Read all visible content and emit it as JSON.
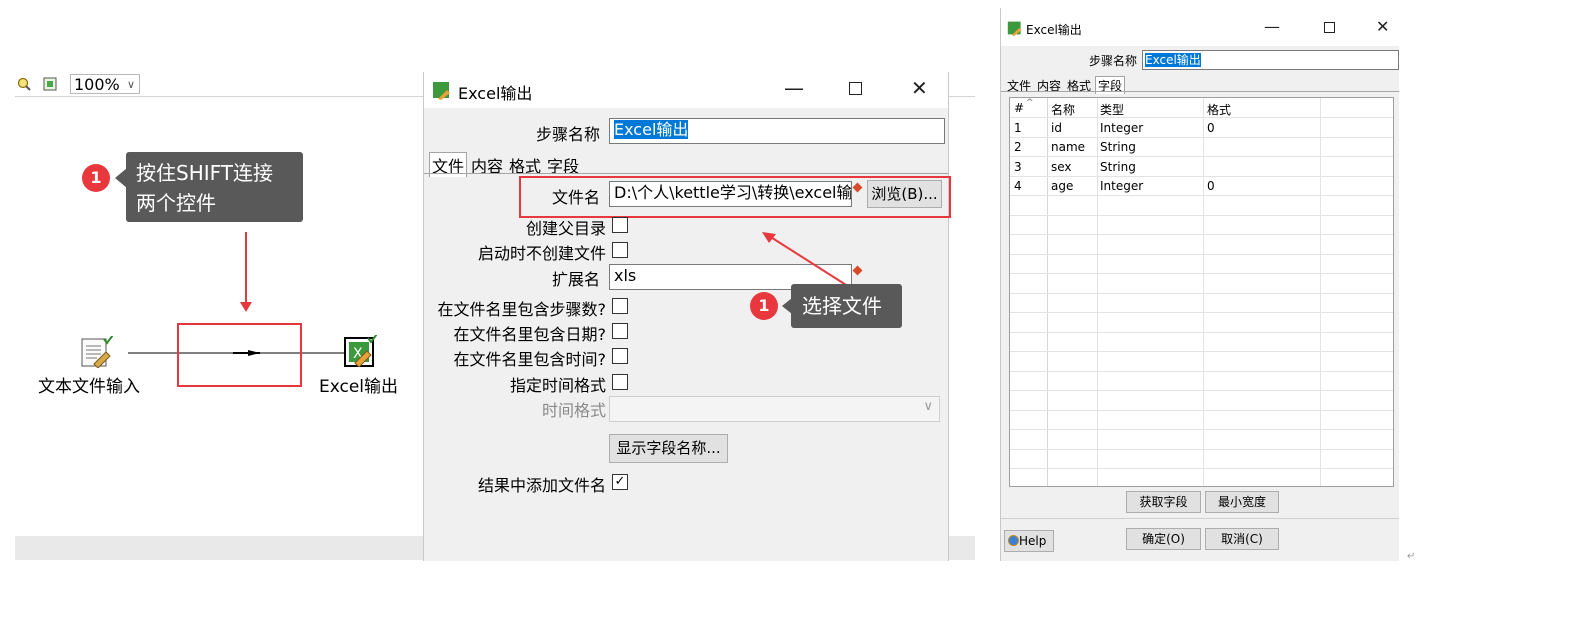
{
  "canvas": {
    "zoom": "100%",
    "steps": {
      "input_label": "文本文件输入",
      "output_label": "Excel输出"
    },
    "callout_badge": "1",
    "callout_text_line1": "按住SHIFT连接",
    "callout_text_line2": "两个控件"
  },
  "dialog1": {
    "title": "Excel输出",
    "step_name_label": "步骤名称",
    "step_name_value": "Excel输出",
    "tabs": [
      "文件",
      "内容",
      "格式",
      "字段"
    ],
    "filename_label": "文件名",
    "filename_value": "D:\\个人\\kettle学习\\转换\\excel输",
    "browse_button": "浏览(B)...",
    "create_parent_label": "创建父目录",
    "no_create_on_start_label": "启动时不创建文件",
    "extension_label": "扩展名",
    "extension_value": "xls",
    "include_stepnr_label": "在文件名里包含步骤数?",
    "include_date_label": "在文件名里包含日期?",
    "include_time_label": "在文件名里包含时间?",
    "specify_time_format_label": "指定时间格式",
    "time_format_label": "时间格式",
    "show_fields_button": "显示字段名称...",
    "add_to_result_label": "结果中添加文件名",
    "callout_badge": "1",
    "callout_text": "选择文件"
  },
  "dialog2": {
    "title": "Excel输出",
    "step_name_label": "步骤名称",
    "step_name_value": "Excel输出",
    "tabs": [
      "文件",
      "内容",
      "格式",
      "字段"
    ],
    "columns": [
      "#",
      "名称",
      "类型",
      "格式"
    ],
    "rows": [
      {
        "n": "1",
        "name": "id",
        "type": "Integer",
        "format": "0"
      },
      {
        "n": "2",
        "name": "name",
        "type": "String",
        "format": ""
      },
      {
        "n": "3",
        "name": "sex",
        "type": "String",
        "format": ""
      },
      {
        "n": "4",
        "name": "age",
        "type": "Integer",
        "format": "0"
      }
    ],
    "get_fields_button": "获取字段",
    "min_width_button": "最小宽度",
    "help_button": "Help",
    "ok_button": "确定(O)",
    "cancel_button": "取消(C)"
  },
  "colors": {
    "accent_red": "#e8383d",
    "callout_bg": "#595959",
    "selection_blue": "#0078d7"
  }
}
